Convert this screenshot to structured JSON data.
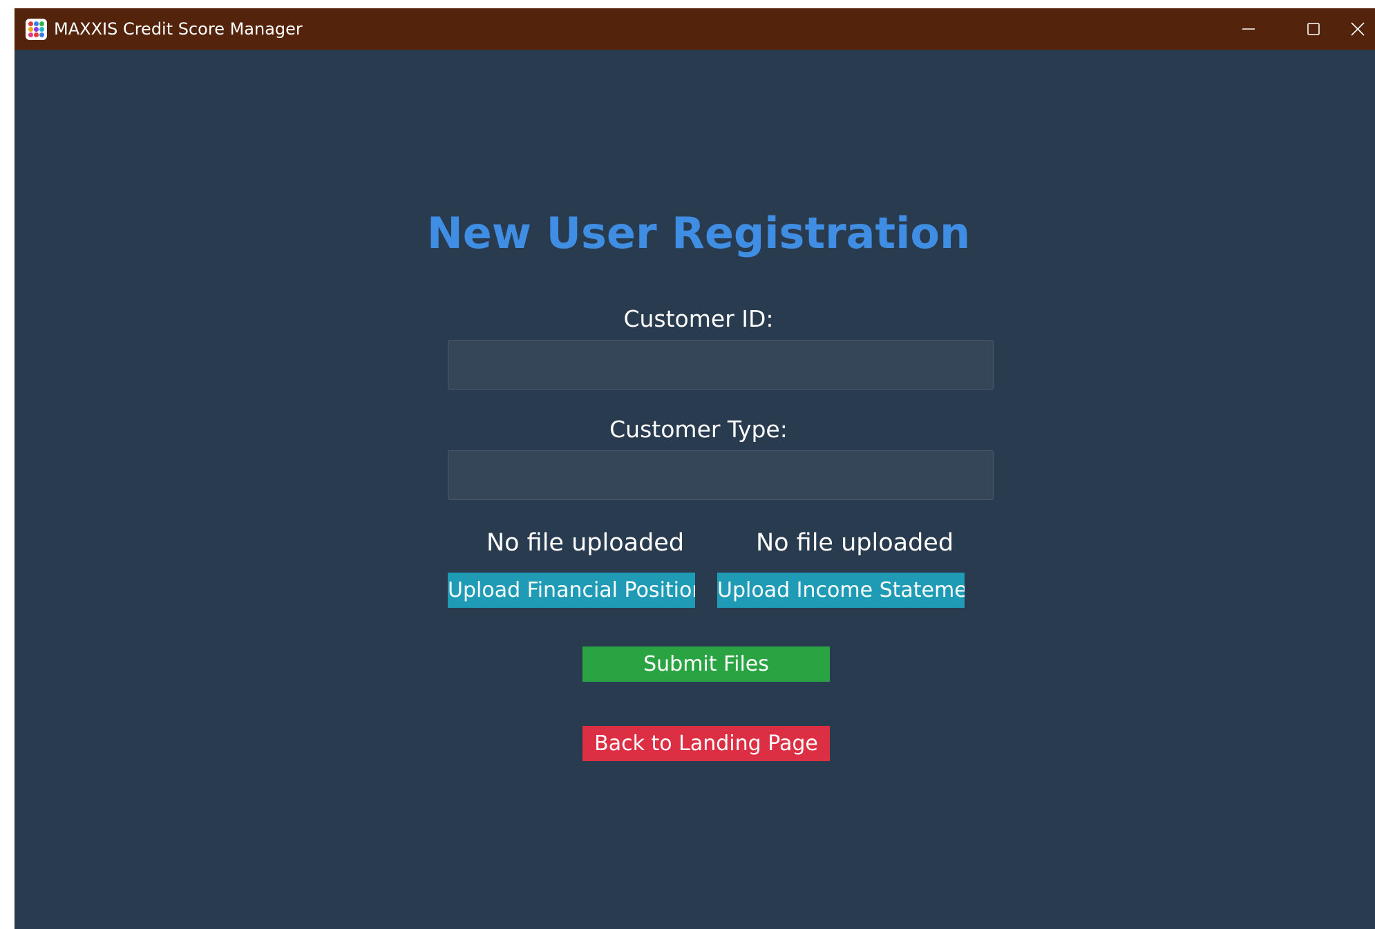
{
  "window": {
    "title": "MAXXIS Credit Score Manager",
    "icon": "app-icon",
    "controls": {
      "minimize_icon": "minimize-icon",
      "maximize_icon": "maximize-icon",
      "close_icon": "close-icon"
    }
  },
  "form": {
    "heading": "New User Registration",
    "customer_id": {
      "label": "Customer ID:",
      "value": "",
      "placeholder": ""
    },
    "customer_type": {
      "label": "Customer Type:",
      "value": "",
      "placeholder": ""
    },
    "uploads": [
      {
        "status": "No file uploaded",
        "button_label": "Upload Financial Position"
      },
      {
        "status": "No file uploaded",
        "button_label": "Upload Income Statement"
      }
    ],
    "submit_label": "Submit Files",
    "back_label": "Back to Landing Page"
  },
  "colors": {
    "titlebar": "#53230b",
    "background": "#283b4f",
    "heading": "#3f8ee4",
    "input_bg": "#344658",
    "upload_button": "#1f9bb6",
    "submit_button": "#2aa442",
    "back_button": "#dd2f43"
  }
}
